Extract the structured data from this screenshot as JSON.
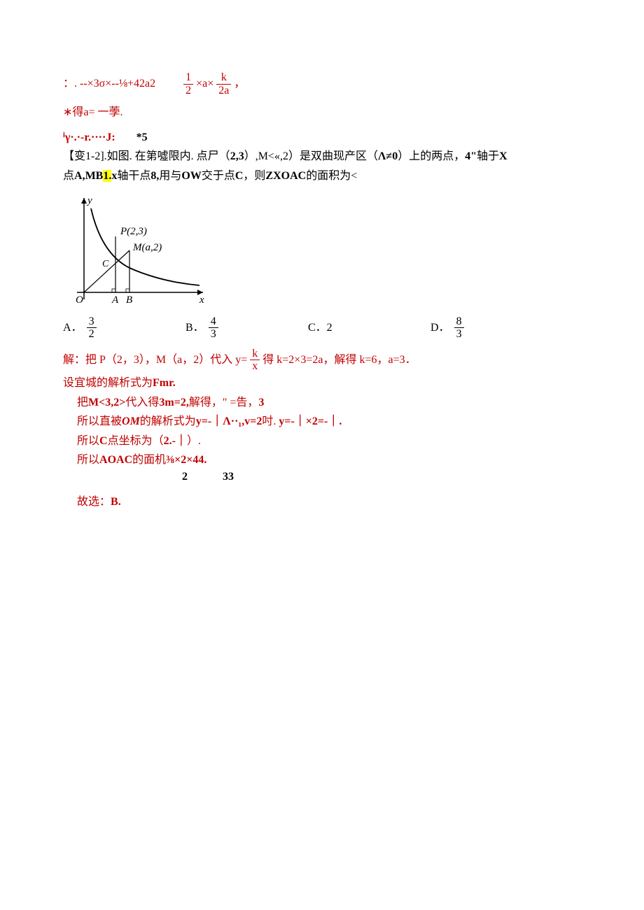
{
  "top": {
    "eq_left": "：. --×3σ×--⅛+42a2",
    "eq_right_pre": "",
    "eq_frac1_num": "1",
    "eq_frac1_den": "2",
    "eq_mid1": "×a×",
    "eq_frac2_num": "k",
    "eq_frac2_den": "2a",
    "eq_tail": "，",
    "line2": "∗得a= 一荸.",
    "line3": "ⁱγ·.·-r.····J:",
    "line3b": "*5"
  },
  "problem": {
    "tag": "【变1-2].",
    "body1": "如图. 在第噓限内. 点尸（",
    "b1": "2,3",
    "body2": "）,M<«,2）是双曲现产区（",
    "b2": "Λ≠0",
    "body3": "）上的两点，",
    "b3": "4\"",
    "body4": "轴于",
    "b4": "X",
    "line2a": "点",
    "l2b1": "A,MB",
    "l2hl": "1.",
    "l2b2": "x",
    "l2c": "轴干点",
    "l2b3": "8,",
    "l2d": "用与",
    "l2b4": "OW",
    "l2e": "交于点",
    "l2b5": "C",
    "l2f": "，则",
    "l2b6": "ZXOAC",
    "l2g": "的面积为<"
  },
  "graph": {
    "y": "y",
    "P": "P(2,3)",
    "M": "M(a,2)",
    "C": "C",
    "O": "O",
    "A": "A",
    "B": "B",
    "x": "x"
  },
  "options": {
    "A": "A．",
    "A_num": "3",
    "A_den": "2",
    "B": "B．",
    "B_num": "4",
    "B_den": "3",
    "C": "C．2",
    "D": "D．",
    "D_num": "8",
    "D_den": "3"
  },
  "solution": {
    "l1a": "解：把 P（2，3），M（a，2）代入 y=",
    "l1_num": "k",
    "l1_den": "x",
    "l1b": "得 k=2×3=2a，解得 k=6，a=3．",
    "l2": "设宜城的解析式为",
    "l2b": "Fmr.",
    "l3a": "把",
    "l3b": "M<3,2>",
    "l3c": "代入得",
    "l3d": "3m=2,",
    "l3e": "解得，",
    "l3f": "\" =告，",
    "l3g": "3",
    "l4a": "所以直被",
    "l4b": "OM",
    "l4c": "的解析式为",
    "l4d": "y=-｜Λ··₁,v=2",
    "l4e": "吋. ",
    "l4f": "y=-｜×2=-｜.",
    "l5a": "所以",
    "l5b": "C",
    "l5c": "点坐标为（",
    "l5d": "2.-｜",
    "l5e": "）.",
    "l6a": "所以",
    "l6b": "AOAC",
    "l6c": "的面机",
    "l6d": "⅜×2×44.",
    "l6e": "2",
    "l6f": "33",
    "l7": "故选：",
    "l7b": "B."
  }
}
